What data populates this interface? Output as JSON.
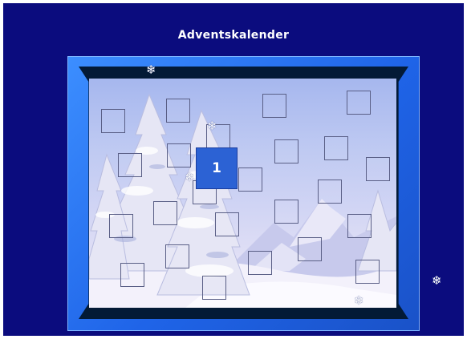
{
  "app": {
    "title": "Adventskalender",
    "background_color": "#0b0c7e",
    "frame_color": "#2a72f0"
  },
  "calendar": {
    "opened_door": {
      "number": "1"
    },
    "doors_total": 24,
    "snowflake_icon": "snowflake-icon"
  }
}
